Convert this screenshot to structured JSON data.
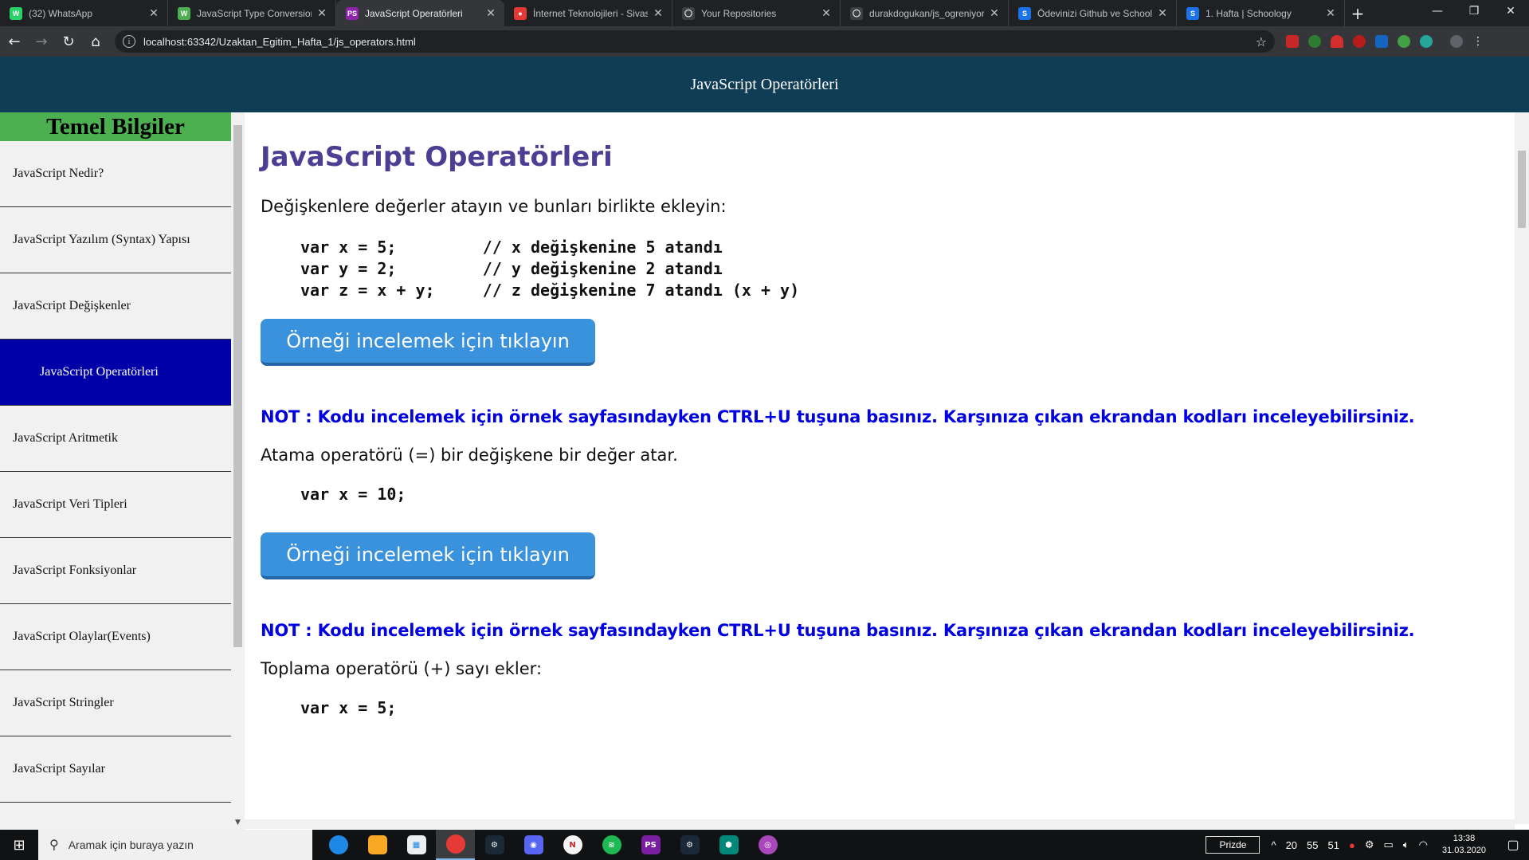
{
  "browser": {
    "tabs": [
      {
        "title": "(32) WhatsApp",
        "fav_color": "#25d366",
        "fav_glyph": "W",
        "active": false
      },
      {
        "title": "JavaScript Type Conversion",
        "fav_color": "#4caf50",
        "fav_glyph": "W",
        "active": false
      },
      {
        "title": "JavaScript Operatörleri",
        "fav_color": "#8e24aa",
        "fav_glyph": "PS",
        "active": true
      },
      {
        "title": "İnternet Teknolojileri - Sivas",
        "fav_color": "#e53935",
        "fav_glyph": "●",
        "active": false
      },
      {
        "title": "Your Repositories",
        "fav_color": "#3c4043",
        "fav_glyph": "◯",
        "active": false
      },
      {
        "title": "durakdogukan/js_ogreniyor",
        "fav_color": "#3c4043",
        "fav_glyph": "◯",
        "active": false
      },
      {
        "title": "Ödevinizi Github ve Schoolo",
        "fav_color": "#1a73e8",
        "fav_glyph": "S",
        "active": false
      },
      {
        "title": "1. Hafta | Schoology",
        "fav_color": "#1a73e8",
        "fav_glyph": "S",
        "active": false
      }
    ],
    "url": "localhost:63342/Uzaktan_Egitim_Hafta_1/js_operators.html"
  },
  "header": {
    "title": "JavaScript Operatörleri"
  },
  "sidebar": {
    "title": "Temel Bilgiler",
    "items": [
      {
        "label": "JavaScript Nedir?"
      },
      {
        "label": "JavaScript Yazılım (Syntax) Yapısı"
      },
      {
        "label": "JavaScript Değişkenler"
      },
      {
        "label": "JavaScript Operatörleri"
      },
      {
        "label": "JavaScript Aritmetik"
      },
      {
        "label": "JavaScript Veri Tipleri"
      },
      {
        "label": "JavaScript Fonksiyonlar"
      },
      {
        "label": "JavaScript Olaylar(Events)"
      },
      {
        "label": "JavaScript Stringler"
      },
      {
        "label": "JavaScript Sayılar"
      }
    ],
    "active_index": 3
  },
  "main": {
    "heading": "JavaScript Operatörleri",
    "intro": "Değişkenlere değerler atayın ve bunları birlikte ekleyin:",
    "code1": "var x = 5;         // x değişkenine 5 atandı\nvar y = 2;         // y değişkenine 2 atandı\nvar z = x + y;     // z değişkenine 7 atandı (x + y)",
    "button_label": "Örneği incelemek için tıklayın",
    "note": "NOT : Kodu incelemek için örnek sayfasındayken CTRL+U tuşuna basınız. Karşınıza çıkan ekrandan kodları inceleyebilirsiniz.",
    "assign_text": "Atama operatörü (=) bir değişkene bir değer atar.",
    "code2": "var x = 10;",
    "add_text": "Toplama operatörü (+) sayı ekler:",
    "code3": "var x = 5;"
  },
  "taskbar": {
    "search_placeholder": "Aramak için buraya yazın",
    "keyboard": "Prizde",
    "tray_numbers": [
      "20",
      "55",
      "51"
    ],
    "time": "13:38",
    "date": "31.03.2020"
  }
}
